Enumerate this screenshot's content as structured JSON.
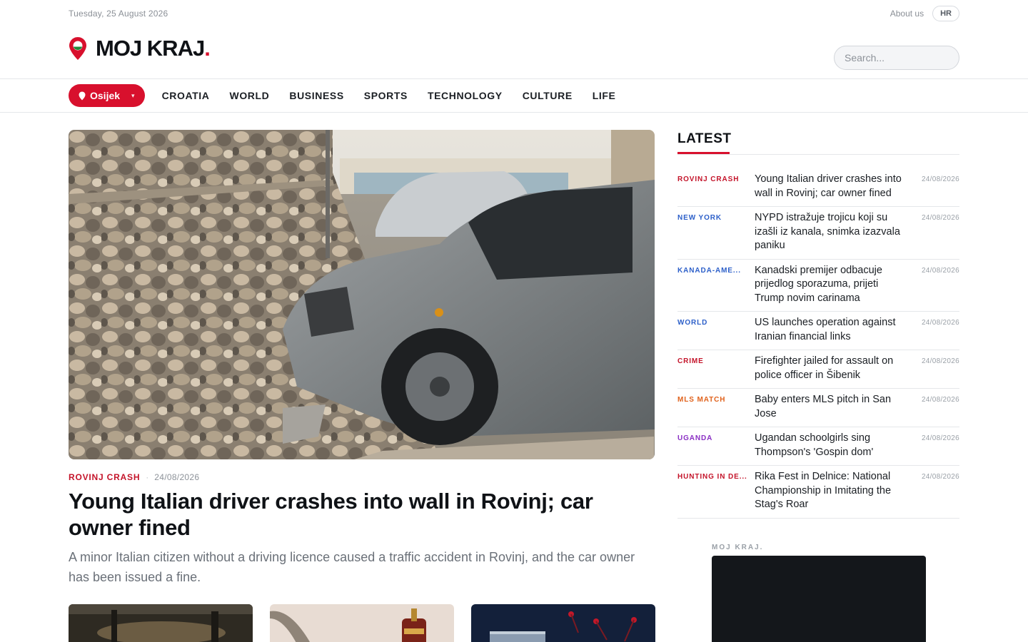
{
  "topbar": {
    "date": "Tuesday, 25 August 2026",
    "about": "About us",
    "lang": "HR"
  },
  "brand": {
    "name": "MOJ KRAJ",
    "dot": ".",
    "accent_color": "#d8102d"
  },
  "search": {
    "placeholder": "Search..."
  },
  "nav": {
    "city": "Osijek",
    "caret": "▾",
    "items": [
      "CROATIA",
      "WORLD",
      "BUSINESS",
      "SPORTS",
      "TECHNOLOGY",
      "CULTURE",
      "LIFE"
    ]
  },
  "hero": {
    "category": "ROVINJ CRASH",
    "separator": "·",
    "date": "24/08/2026",
    "title": "Young Italian driver crashes into wall in Rovinj; car owner fined",
    "subtitle": "A minor Italian citizen without a driving licence caused a traffic accident in Rovinj, and the car owner has been issued a fine."
  },
  "latest": {
    "heading": "LATEST",
    "items": [
      {
        "tag": "ROVINJ CRASH",
        "tag_color": "#c4142a",
        "title": "Young Italian driver crashes into wall in Rovinj; car owner fined",
        "date": "24/08/2026"
      },
      {
        "tag": "NEW YORK",
        "tag_color": "#2c5fc9",
        "title": "NYPD istražuje trojicu koji su izašli iz kanala, snimka izazvala paniku",
        "date": "24/08/2026"
      },
      {
        "tag": "KANADA-AME...",
        "tag_color": "#2c5fc9",
        "title": "Kanadski premijer odbacuje prijedlog sporazuma, prijeti Trump novim carinama",
        "date": "24/08/2026"
      },
      {
        "tag": "WORLD",
        "tag_color": "#2c5fc9",
        "title": "US launches operation against Iranian financial links",
        "date": "24/08/2026"
      },
      {
        "tag": "CRIME",
        "tag_color": "#c4142a",
        "title": "Firefighter jailed for assault on police officer in Šibenik",
        "date": "24/08/2026"
      },
      {
        "tag": "MLS MATCH",
        "tag_color": "#e0621c",
        "title": "Baby enters MLS pitch in San Jose",
        "date": "24/08/2026"
      },
      {
        "tag": "UGANDA",
        "tag_color": "#8a2fc4",
        "title": "Ugandan schoolgirls sing Thompson's 'Gospin dom'",
        "date": "24/08/2026"
      },
      {
        "tag": "HUNTING IN DE...",
        "tag_color": "#c4142a",
        "title": "Rika Fest in Delnice: National Championship in Imitating the Stag's Roar",
        "date": "24/08/2026"
      }
    ]
  },
  "ad": {
    "label": "MOJ KRAJ."
  }
}
